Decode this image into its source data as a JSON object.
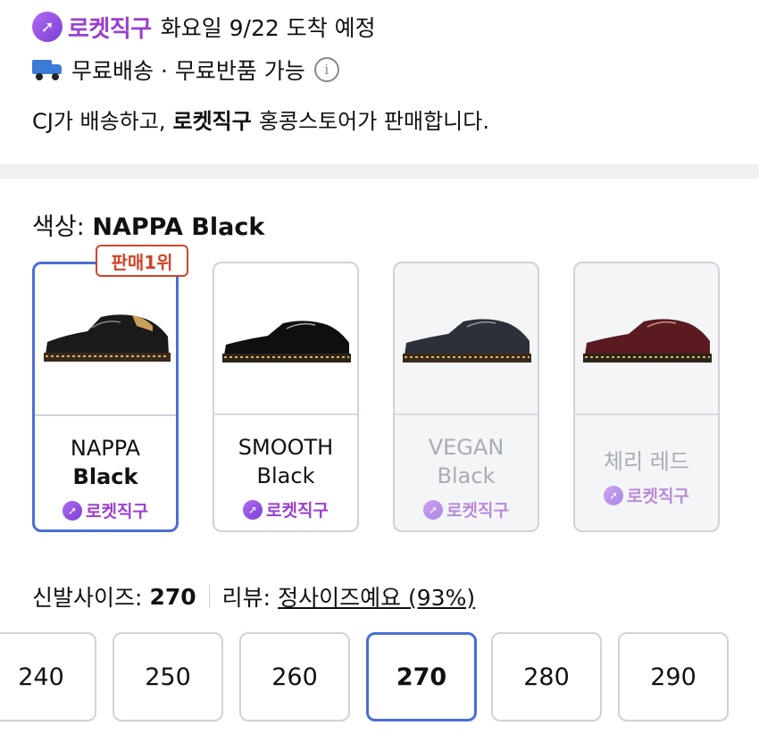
{
  "delivery": {
    "rocket_label": "로켓직구",
    "arrival": "화요일 9/22 도착 예정",
    "shipping": "무료배송 · 무료반품 가능",
    "seller_prefix": "CJ가 배송하고,",
    "seller_brand": "로켓직구",
    "seller_suffix": "홍콩스토어가 판매합니다."
  },
  "color": {
    "label": "색상:",
    "selected": "NAPPA Black",
    "best_tag": "판매1위",
    "options": [
      {
        "line1": "NAPPA",
        "line2": "Black",
        "badge": "로켓직구",
        "selected": true,
        "disabled": false
      },
      {
        "line1": "SMOOTH",
        "line2": "Black",
        "badge": "로켓직구",
        "selected": false,
        "disabled": false
      },
      {
        "line1": "VEGAN",
        "line2": "Black",
        "badge": "로켓직구",
        "selected": false,
        "disabled": true
      },
      {
        "line1": "체리 레드",
        "line2": "",
        "badge": "로켓직구",
        "selected": false,
        "disabled": true
      }
    ]
  },
  "size": {
    "label": "신발사이즈:",
    "selected": "270",
    "review_label": "리뷰:",
    "review_value": "정사이즈예요 (93%)",
    "options": [
      "240",
      "250",
      "260",
      "270",
      "280",
      "290"
    ]
  },
  "colors": {
    "rocket_purple": "#9b3fcf",
    "select_blue": "#4a6ed6",
    "tag_red": "#d0442a"
  }
}
